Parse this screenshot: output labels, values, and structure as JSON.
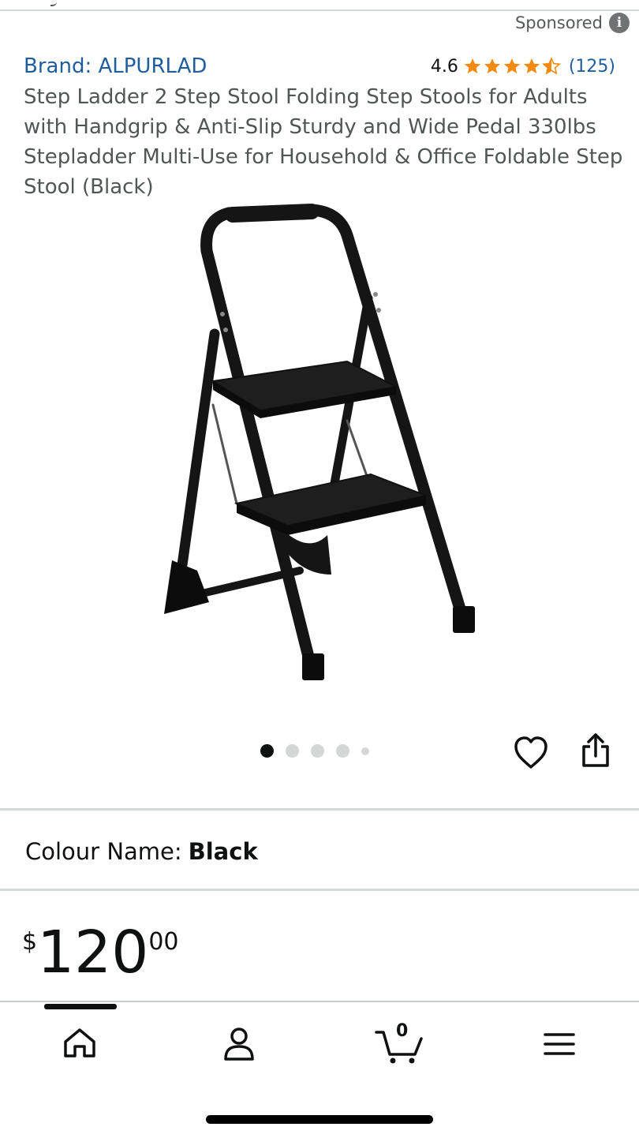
{
  "sponsored": {
    "label": "Sponsored",
    "icon": "info-icon"
  },
  "product": {
    "brand": "Brand: ALPURLAD",
    "rating": "4.6",
    "rating_count": "(125)",
    "star_color": "#f3890f",
    "title": "Step Ladder 2 Step Stool Folding Step Stools for Adults with Handgrip & Anti-Slip Sturdy and Wide Pedal 330lbs Stepladder Multi-Use for Household & Office Foldable Step Stool (Black)",
    "image": "step-ladder-image"
  },
  "gallery": {
    "dot_count": 5,
    "active_index": 0
  },
  "actions": {
    "wishlist_icon": "heart-icon",
    "share_icon": "share-icon"
  },
  "colour": {
    "label": "Colour Name:",
    "value": "Black"
  },
  "price": {
    "symbol": "$",
    "whole": "120",
    "fraction": "00"
  },
  "bottom_nav": {
    "items": [
      {
        "name": "home",
        "icon": "home-icon"
      },
      {
        "name": "account",
        "icon": "user-icon"
      },
      {
        "name": "cart",
        "icon": "cart-icon",
        "count": "0"
      },
      {
        "name": "menu",
        "icon": "menu-icon"
      }
    ],
    "active_index": 0
  },
  "colors": {
    "link": "#1f5e9e",
    "text": "#0f1111",
    "muted": "#565959",
    "divider": "#d5d9d9"
  }
}
